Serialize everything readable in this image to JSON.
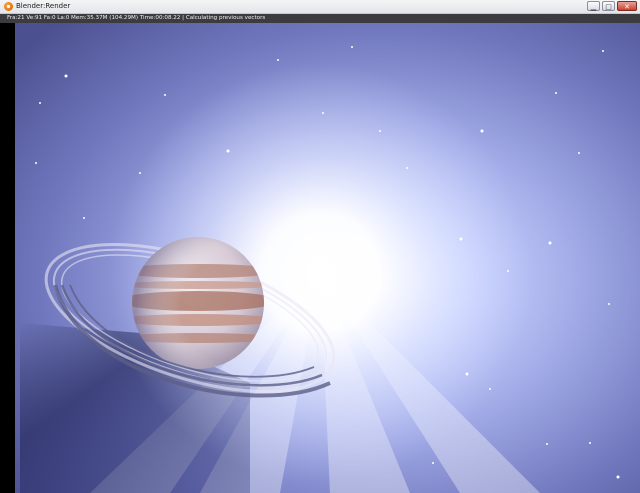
{
  "window": {
    "title": "Blender:Render",
    "icon": "blender-icon",
    "controls": {
      "minimize": "minimize-icon",
      "maximize": "maximize-icon",
      "close": "close-icon"
    }
  },
  "status": {
    "text": "Fra:21  Ve:91 Fa:0 La:0 Mem:35.37M (104.29M) Time:00:08.22 | Calculating previous vectors"
  },
  "render": {
    "colors": {
      "sky_light": "#c9d3ff",
      "sky_mid": "#8b93d6",
      "sky_dark": "#4b5190",
      "glow": "#ffffff",
      "planet_base": "#e7dee6",
      "band": "#b48478"
    }
  }
}
